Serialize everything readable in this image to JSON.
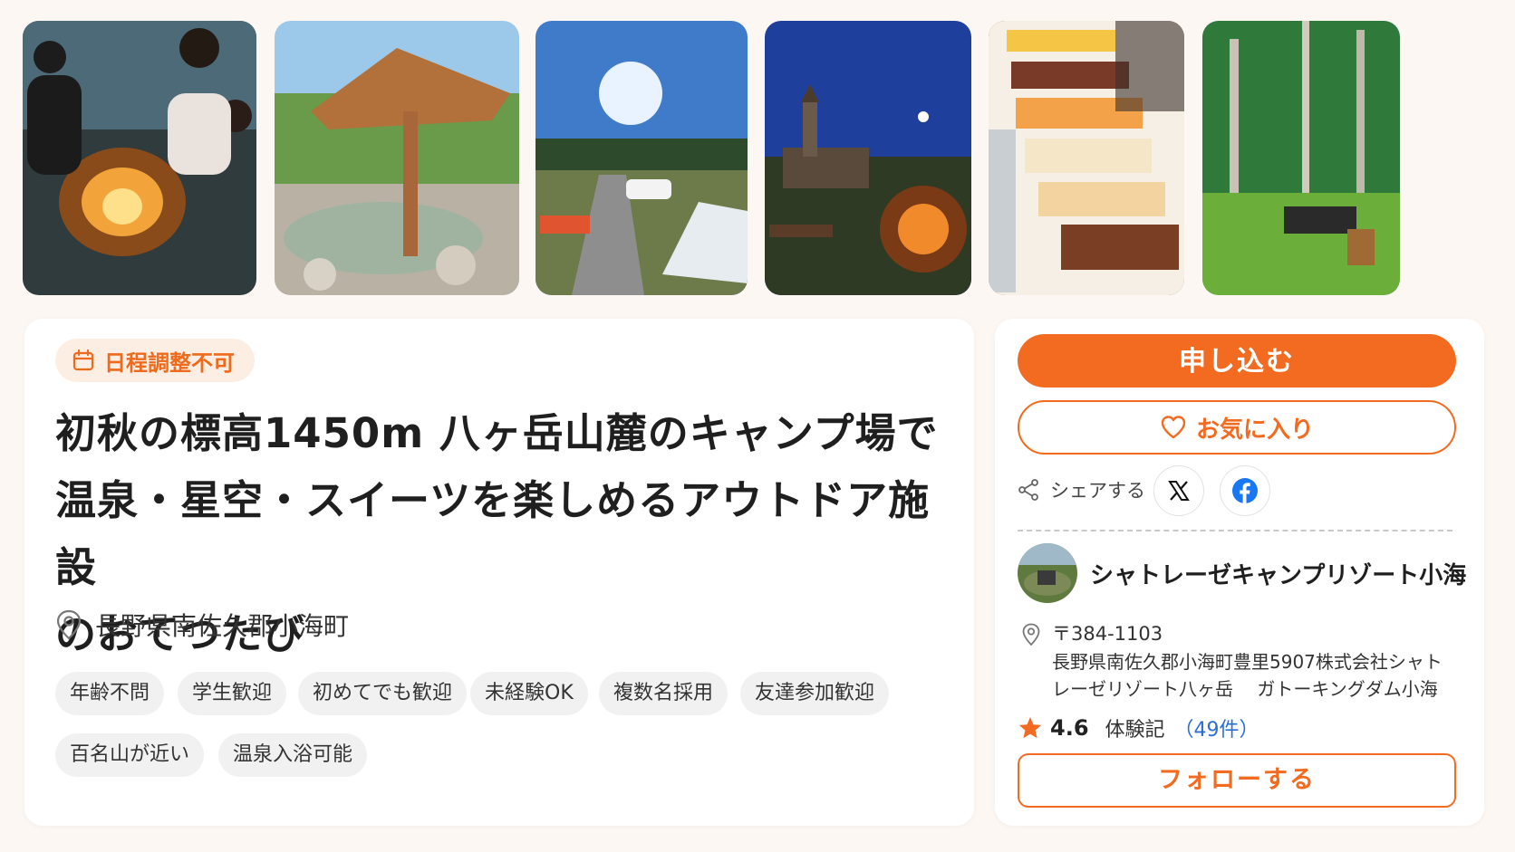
{
  "photos": [
    {
      "name": "campfire-photo"
    },
    {
      "name": "hot-spring-photo"
    },
    {
      "name": "campsite-photo"
    },
    {
      "name": "night-clocktower-photo"
    },
    {
      "name": "sweets-buffet-photo"
    },
    {
      "name": "forest-hammock-photo"
    }
  ],
  "event": {
    "schedule_badge": "日程調整不可",
    "title_lines": [
      "初秋の標高1450m 八ヶ岳山麓のキャンプ場で",
      "温泉・星空・スイーツを楽しめるアウトドア施設",
      "のおてつたび"
    ],
    "location": "長野県南佐久郡小海町",
    "tags": [
      "年齢不問",
      "学生歓迎",
      "初めてでも歓迎",
      "未経験OK",
      "複数名採用",
      "友達参加歓迎",
      "百名山が近い",
      "温泉入浴可能"
    ]
  },
  "sidebar": {
    "apply_label": "申し込む",
    "favorite_label": "お気に入り",
    "share_label": "シェアする",
    "org_name": "シャトレーゼキャンプリゾート小海",
    "postal": "〒384-1103",
    "address_lines": [
      "長野県南佐久郡小海町豊里5907株式会社シャト",
      "レーゼリゾート八ヶ岳　 ガトーキングダム小海"
    ],
    "rating": "4.6",
    "review_label": "体験記",
    "review_count": "（49件）",
    "follow_label": "フォローする"
  },
  "colors": {
    "accent": "#f26b21",
    "badge_bg": "#fdeee3",
    "link": "#2a6fd6",
    "star": "#f26b21"
  }
}
